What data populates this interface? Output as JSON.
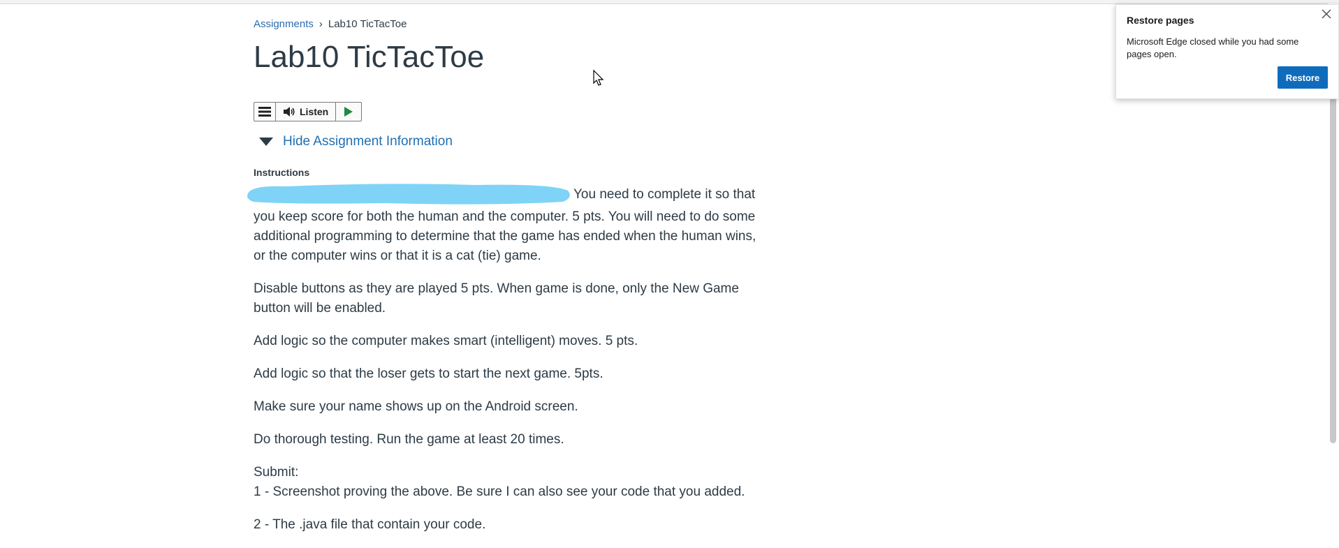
{
  "breadcrumb": {
    "parent": "Assignments",
    "separator": "›",
    "current": "Lab10 TicTacToe"
  },
  "page_title": "Lab10 TicTacToe",
  "toolbar": {
    "listen_label": "Listen"
  },
  "toggle_label": "Hide Assignment Information",
  "instructions": {
    "label": "Instructions",
    "paragraphs": [
      "You need to complete it so that you keep score for both the human and the computer. 5 pts. You will need to do some additional programming to determine that the game has ended when the human wins, or the computer wins or that it is a cat (tie) game.",
      "Disable buttons as they are played 5 pts. When game is done, only the New Game button will be enabled.",
      "Add logic so the computer makes smart (intelligent) moves. 5 pts.",
      "Add logic so that the loser gets to start the next game. 5pts.",
      "Make sure your name shows up on the Android screen.",
      "Do thorough testing. Run the game at least 20 times."
    ],
    "submit_heading": "Submit:",
    "submit_items": [
      "1 - Screenshot proving the above. Be sure I can also see your code that you added.",
      "2 - The .java file that contain your code."
    ]
  },
  "popup": {
    "title": "Restore pages",
    "message": "Microsoft Edge closed while you had some pages open.",
    "button": "Restore",
    "close_icon": "close-icon"
  },
  "colors": {
    "link": "#2b6cb0",
    "toggle": "#1f6fb2",
    "redaction": "#7fd3f7",
    "restore_button": "#0f6cbd"
  }
}
